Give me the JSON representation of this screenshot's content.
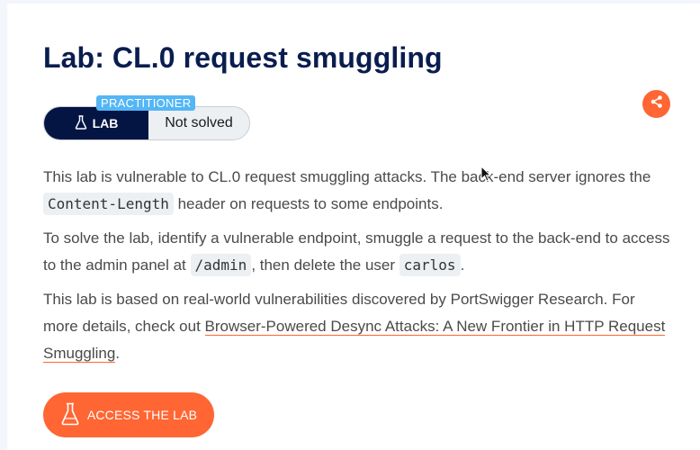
{
  "header": {
    "title": "Lab: CL.0 request smuggling"
  },
  "badge": {
    "level": "PRACTITIONER",
    "lab_label": "LAB",
    "status": "Not solved"
  },
  "description": {
    "p1": {
      "before": "This lab is vulnerable to CL.0 request smuggling attacks. The back-end server ignores the ",
      "code": "Content-Length",
      "after": " header on requests to some endpoints."
    },
    "p2": {
      "before": "To solve the lab, identify a vulnerable endpoint, smuggle a request to the back-end to access to the admin panel at ",
      "code1": "/admin",
      "middle": ", then delete the user ",
      "code2": "carlos",
      "after": "."
    },
    "p3": {
      "before": "This lab is based on real-world vulnerabilities discovered by PortSwigger Research. For more details, check out ",
      "link": "Browser-Powered Desync Attacks: A New Frontier in HTTP Request Smuggling",
      "after": "."
    }
  },
  "actions": {
    "access_lab": "ACCESS THE LAB"
  },
  "icons": {
    "lab": "flask-icon",
    "share": "share-icon",
    "cursor": "cursor-icon"
  },
  "colors": {
    "title": "#0a1d4f",
    "lab_badge": "#041544",
    "level_badge": "#54b6f5",
    "accent": "#ff6633"
  }
}
